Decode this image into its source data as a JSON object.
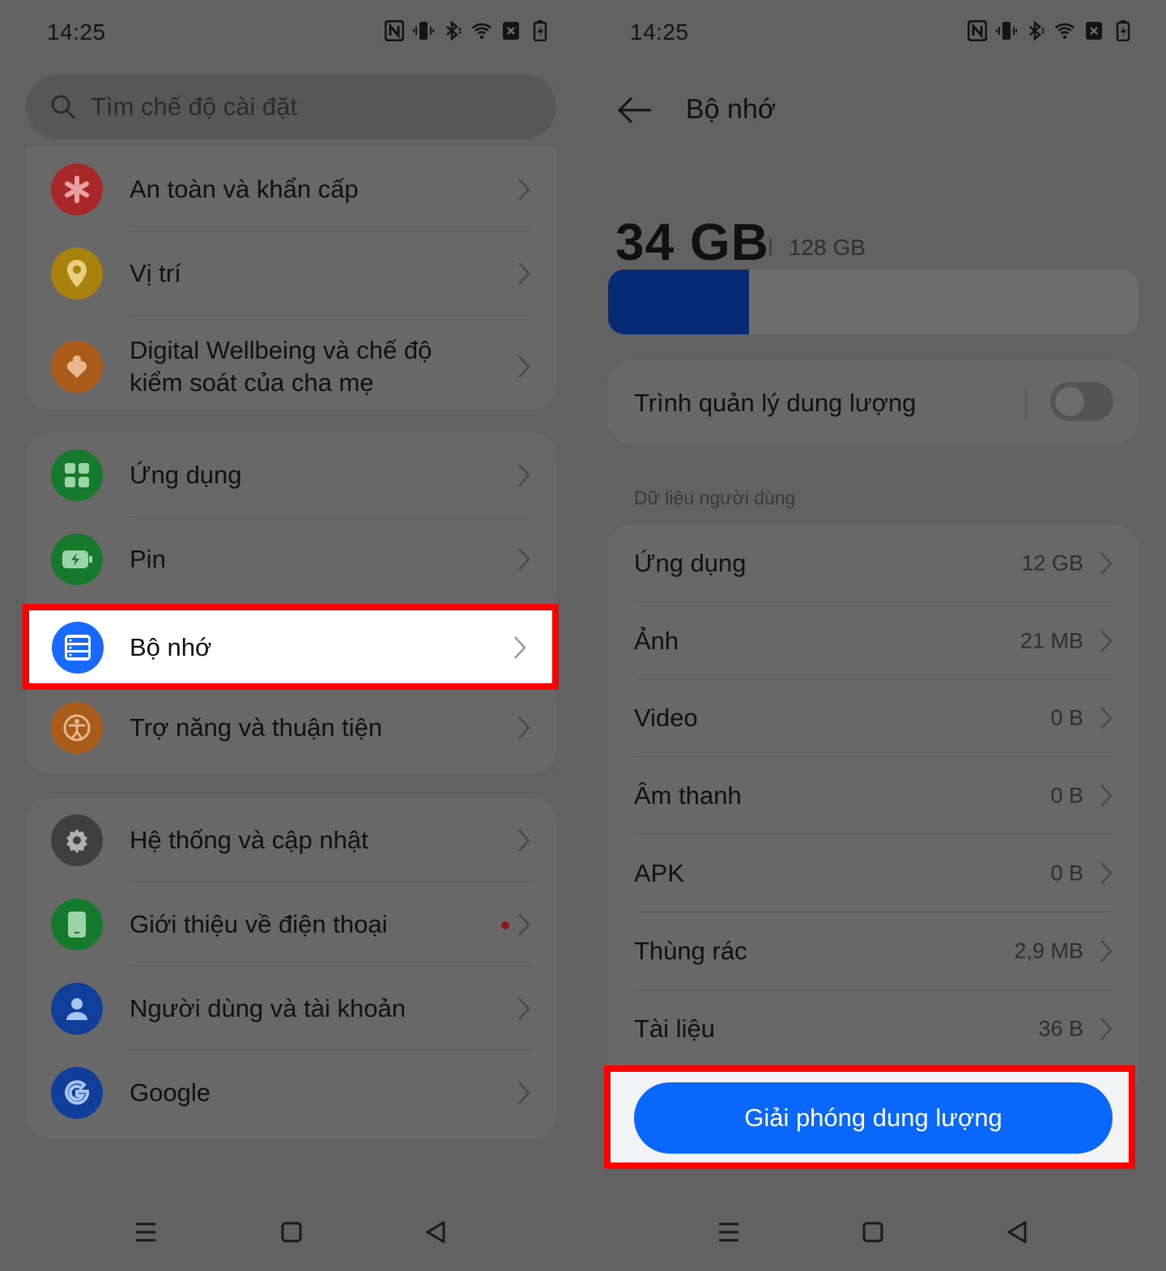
{
  "status_bar": {
    "time": "14:25"
  },
  "left": {
    "search_placeholder": "Tìm chế độ cài đặt",
    "group1": [
      {
        "label": "An toàn và khẩn cấp",
        "icon": "asterisk-icon",
        "color": "#cc2b2b"
      },
      {
        "label": "Vị trí",
        "icon": "location-pin-icon",
        "color": "#d8a20f"
      },
      {
        "label": "Digital Wellbeing và chế độ kiểm soát của cha mẹ",
        "icon": "heart-person-icon",
        "color": "#d2741c"
      }
    ],
    "group2": [
      {
        "label": "Ứng dụng",
        "icon": "apps-grid-icon",
        "color": "#1aa33a"
      },
      {
        "label": "Pin",
        "icon": "battery-icon",
        "color": "#1aa33a"
      },
      {
        "label": "Bộ nhớ",
        "icon": "storage-icon",
        "color": "#1769ff"
      },
      {
        "label": "Trợ năng và thuận tiện",
        "icon": "accessibility-icon",
        "color": "#d2741c"
      }
    ],
    "group3": [
      {
        "label": "Hệ thống và cập nhật",
        "icon": "gear-icon",
        "color": "#555555"
      },
      {
        "label": "Giới thiệu về điện thoại",
        "icon": "phone-icon",
        "color": "#1aa33a"
      },
      {
        "label": "Người dùng và tài khoản",
        "icon": "user-icon",
        "color": "#1769ff"
      },
      {
        "label": "Google",
        "icon": "google-icon",
        "color": "#1769ff"
      }
    ]
  },
  "right": {
    "title": "Bộ nhớ",
    "used": "34 GB",
    "total": "128 GB",
    "used_fraction": 0.265,
    "manager_label": "Trình quản lý dung lượng",
    "section_label": "Dữ liệu người dùng",
    "items": [
      {
        "label": "Ứng dụng",
        "value": "12 GB"
      },
      {
        "label": "Ảnh",
        "value": "21 MB"
      },
      {
        "label": "Video",
        "value": "0 B"
      },
      {
        "label": "Âm thanh",
        "value": "0 B"
      },
      {
        "label": "APK",
        "value": "0 B"
      },
      {
        "label": "Thùng rác",
        "value": "2,9 MB"
      },
      {
        "label": "Tài liệu",
        "value": "36 B"
      }
    ],
    "cta_label": "Giải phóng dung lượng"
  },
  "colors": {
    "accent": "#0a67fc",
    "highlight": "#ff0000",
    "storage_fill": "#062a73"
  }
}
